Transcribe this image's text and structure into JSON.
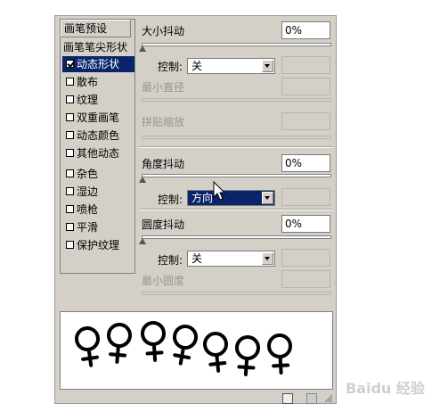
{
  "brush_panel": {
    "list": {
      "header": "画笔预设",
      "items": [
        {
          "label": "画笔笔尖形状",
          "checkbox": false,
          "checked": false
        },
        {
          "label": "动态形状",
          "checkbox": true,
          "checked": true,
          "selected": true
        },
        {
          "label": "散布",
          "checkbox": true,
          "checked": false
        },
        {
          "label": "纹理",
          "checkbox": true,
          "checked": false
        },
        {
          "label": "双重画笔",
          "checkbox": true,
          "checked": false
        },
        {
          "label": "动态颜色",
          "checkbox": true,
          "checked": false
        },
        {
          "label": "其他动态",
          "checkbox": true,
          "checked": false
        },
        {
          "label": "杂色",
          "checkbox": true,
          "checked": false
        },
        {
          "label": "湿边",
          "checkbox": true,
          "checked": false
        },
        {
          "label": "喷枪",
          "checkbox": true,
          "checked": false
        },
        {
          "label": "平滑",
          "checkbox": true,
          "checked": false
        },
        {
          "label": "保护纹理",
          "checkbox": true,
          "checked": false
        }
      ]
    },
    "size_jitter": {
      "label": "大小抖动",
      "value": "0%",
      "control_label": "控制:",
      "control_value": "关",
      "min_diameter_label": "最小直径",
      "tilt_scale_label": "拼贴缩放"
    },
    "angle_jitter": {
      "label": "角度抖动",
      "value": "0%",
      "control_label": "控制:",
      "control_value": "方向"
    },
    "roundness_jitter": {
      "label": "圆度抖动",
      "value": "0%",
      "control_label": "控制:",
      "control_value": "关",
      "min_roundness_label": "最小圆度"
    }
  },
  "watermark": "Baidu 经验"
}
